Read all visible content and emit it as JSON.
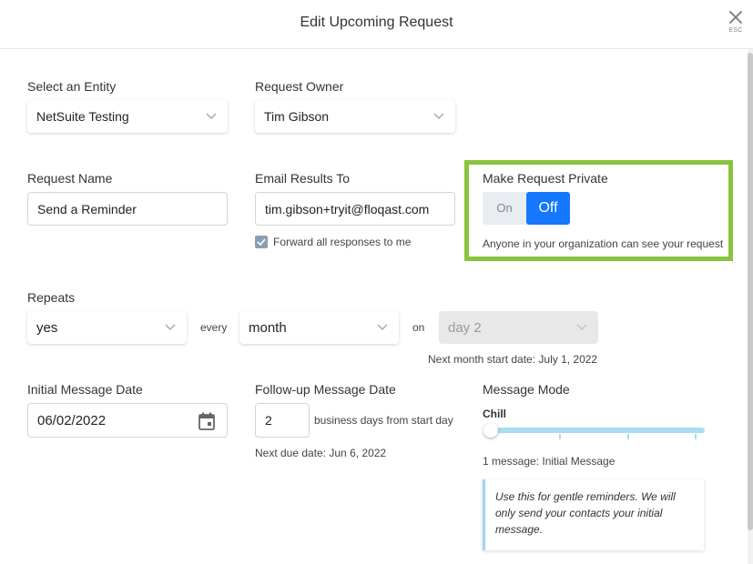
{
  "header": {
    "title": "Edit Upcoming Request",
    "close_hint": "ESC"
  },
  "entity": {
    "label": "Select an Entity",
    "value": "NetSuite Testing"
  },
  "owner": {
    "label": "Request Owner",
    "value": "Tim Gibson"
  },
  "request_name": {
    "label": "Request Name",
    "value": "Send a Reminder"
  },
  "email_results": {
    "label": "Email Results To",
    "value": "tim.gibson+tryit@floqast.com",
    "forward_label": "Forward all responses to me",
    "forward_checked": true
  },
  "private": {
    "label": "Make Request Private",
    "on_label": "On",
    "off_label": "Off",
    "selected": "Off",
    "hint": "Anyone in your organization can see your request",
    "highlight_color": "#8ac43f"
  },
  "repeats": {
    "label": "Repeats",
    "value": "yes",
    "every_label": "every",
    "period": "month",
    "on_label": "on",
    "day": "day 2",
    "next_start": "Next month start date: July 1, 2022"
  },
  "initial_message": {
    "label": "Initial Message Date",
    "value": "06/02/2022"
  },
  "follow_up": {
    "label": "Follow-up Message Date",
    "value": "2",
    "suffix": "business days from start day",
    "next_due": "Next due date: Jun 6, 2022"
  },
  "message_mode": {
    "label": "Message Mode",
    "level_label": "Chill",
    "level_index": 0,
    "level_count": 4,
    "summary": "1 message: Initial Message",
    "note": "Use this for gentle reminders. We will only send your contacts your initial message."
  },
  "colors": {
    "toggle_active": "#1677ff",
    "slider": "#a8ddf0"
  }
}
